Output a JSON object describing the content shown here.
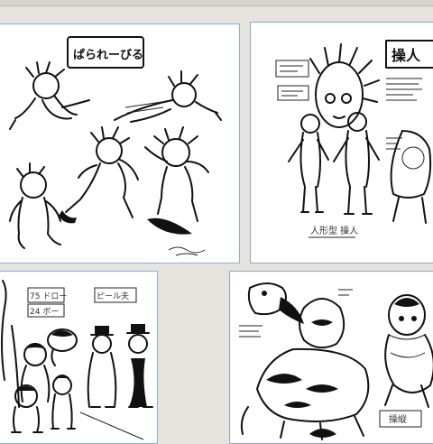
{
  "viewer": {
    "thumbnails": [
      {
        "title_text": "ぱられーびる"
      },
      {
        "title_text": "操人",
        "caption": "人形型 操人"
      },
      {
        "label_a": "75 ドロー",
        "label_b": "24 ボー",
        "label_c": "ピール夫"
      },
      {
        "caption": "操縦"
      }
    ]
  }
}
